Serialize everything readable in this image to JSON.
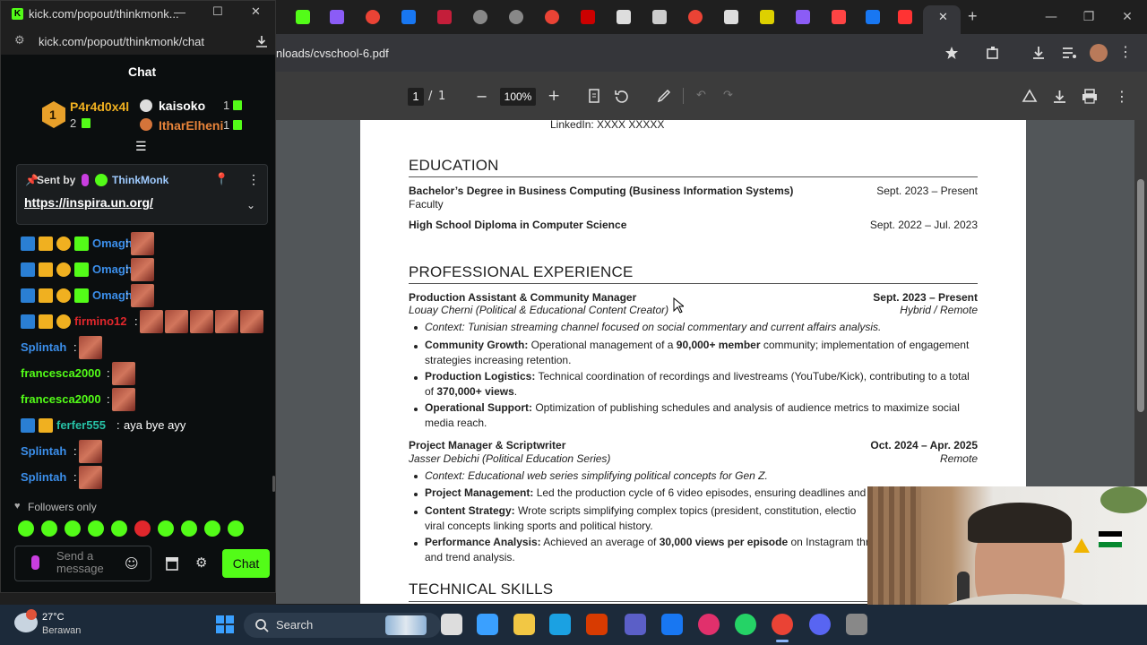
{
  "browser": {
    "address_url": "nloads/cvschool-6.pdf",
    "tab_icon_colors": [
      "#53fc18",
      "#8b5cf6",
      "#ea4335",
      "#1877f2",
      "#c41e3a",
      "#888888",
      "#888888",
      "#ea4335",
      "#cc0000",
      "#dddddd",
      "#cccccc",
      "#ea4335",
      "#dddddd",
      "#ddd000",
      "#8b5cf6",
      "#ff4444",
      "#1877f2",
      "#ff3333"
    ]
  },
  "pdf_toolbar": {
    "page_current": "1",
    "page_separator": "/",
    "page_total": "1",
    "zoom_minus": "−",
    "zoom_value": "100%",
    "zoom_plus": "+"
  },
  "resume": {
    "linkedin": "LinkedIn: XXXX XXXXX",
    "education": {
      "title": "EDUCATION",
      "items": [
        {
          "degree": "Bachelor’s Degree in Business Computing (Business Information Systems)",
          "date": "Sept. 2023 – Present",
          "sub": "Faculty"
        },
        {
          "degree": "High School Diploma in Computer Science",
          "date": "Sept. 2022 – Jul. 2023"
        }
      ]
    },
    "experience": {
      "title": "PROFESSIONAL EXPERIENCE",
      "jobs": [
        {
          "role": "Production Assistant & Community Manager",
          "date": "Sept. 2023 – Present",
          "org": "Louay Cherni (Political & Educational Content Creator)",
          "mode": "Hybrid / Remote",
          "context": "Context: Tunisian streaming channel focused on social commentary and current affairs analysis.",
          "bullets": [
            {
              "lead": "Community Growth:",
              "pre": " Operational management of a ",
              "strong": "90,000+ member",
              "post": " community; implementation of engagement strategies increasing retention."
            },
            {
              "lead": "Production Logistics:",
              "pre": " Technical coordination of recordings and livestreams (YouTube/Kick), contributing to a total of ",
              "strong": "370,000+ views",
              "post": "."
            },
            {
              "lead": "Operational Support:",
              "pre": " Optimization of publishing schedules and analysis of audience metrics to maximize social media reach.",
              "strong": "",
              "post": ""
            }
          ]
        },
        {
          "role": "Project Manager & Scriptwriter",
          "date": "Oct. 2024 – Apr. 2025",
          "org": "Jasser Debichi (Political Education Series)",
          "mode": "Remote",
          "context": "Context: Educational web series simplifying political concepts for Gen Z.",
          "bullets": [
            {
              "lead": "Project Management:",
              "pre": " Led the production cycle of 6 video episodes, ensuring deadlines and",
              "strong": "",
              "post": ""
            },
            {
              "lead": "Content Strategy:",
              "pre": " Wrote scripts simplifying complex topics (president, constitution, electio viral concepts linking sports and political history.",
              "strong": "",
              "post": ""
            },
            {
              "lead": "Performance Analysis:",
              "pre": " Achieved an average of ",
              "strong": "30,000 views per episode",
              "post": " on Instagram thr and trend analysis."
            }
          ]
        }
      ]
    },
    "skills_title": "TECHNICAL SKILLS"
  },
  "chat": {
    "window_title": "kick.com/popout/thinkmonk...",
    "url": "kick.com/popout/thinkmonk/chat",
    "header": "Chat",
    "leaderboard": [
      {
        "name": "P4r4d0x4l",
        "count": "2",
        "rank": "1"
      },
      {
        "name": "kaisoko",
        "count": "1"
      },
      {
        "name": "ItharElheni",
        "count": "1"
      }
    ],
    "pinned": {
      "sent_by_label": "Sent by",
      "author": "ThinkMonk",
      "link": "https://inspira.un.org/"
    },
    "messages": [
      {
        "user": "Omagh",
        "color": "#3b8eea",
        "emotes": 1,
        "badges": 4
      },
      {
        "user": "Omagh",
        "color": "#3b8eea",
        "emotes": 1,
        "badges": 4
      },
      {
        "user": "Omagh",
        "color": "#3b8eea",
        "emotes": 1,
        "badges": 4
      },
      {
        "user": "firmino12",
        "color": "#e0272c",
        "emotes": 5,
        "badges": 3
      },
      {
        "user": "Splintah",
        "color": "#3b8eea",
        "emotes": 1,
        "badges": 0
      },
      {
        "user": "francesca2000",
        "color": "#53fc18",
        "emotes": 1,
        "badges": 0
      },
      {
        "user": "francesca2000",
        "color": "#53fc18",
        "emotes": 1,
        "badges": 0
      },
      {
        "user": "ferfer555",
        "color": "#27c1a6",
        "text": "aya bye ayy",
        "emotes": 0,
        "badges": 2
      },
      {
        "user": "Splintah",
        "color": "#3b8eea",
        "emotes": 1,
        "badges": 0
      },
      {
        "user": "Splintah",
        "color": "#3b8eea",
        "emotes": 1,
        "badges": 0
      }
    ],
    "followers_only": "Followers only",
    "input_placeholder": "Send a message",
    "send_label": "Chat"
  },
  "taskbar": {
    "weather_temp": "27°C",
    "weather_desc": "Berawan",
    "search_label": "Search",
    "app_colors": [
      "#dddddd",
      "#3aa0ff",
      "#f2c744",
      "#1ba1e2",
      "#d83b01",
      "#5b5fc7",
      "#1877f2",
      "#e1306c",
      "#25d366",
      "#ea4335",
      "#5865f2",
      "#888888"
    ]
  }
}
